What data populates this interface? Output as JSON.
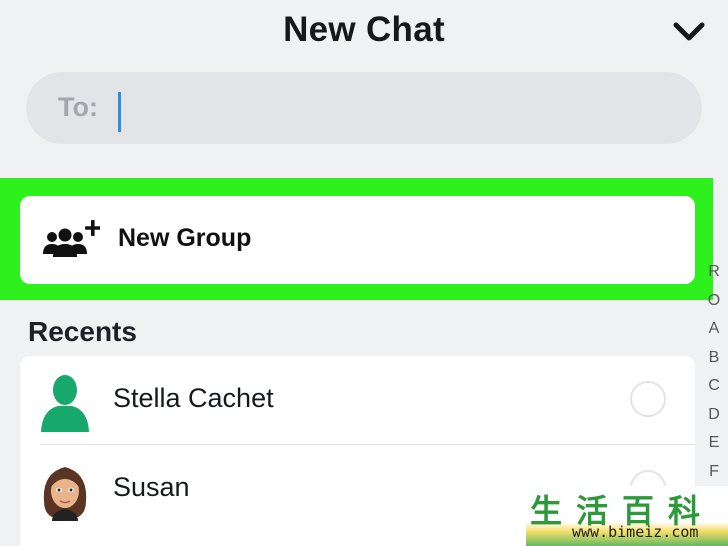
{
  "header": {
    "title": "New Chat",
    "collapse_icon": "chevron-down-icon"
  },
  "to_field": {
    "label": "To:",
    "value": "",
    "placeholder": ""
  },
  "new_group": {
    "icon": "group-add-icon",
    "label": "New Group",
    "highlight_color": "#2ef01c"
  },
  "recents": {
    "title": "Recents",
    "contacts": [
      {
        "name": "Stella Cachet",
        "avatar": "default-ghost-avatar-icon",
        "avatar_color": "#17a86b",
        "selected": false
      },
      {
        "name": "Susan",
        "avatar": "bitmoji-avatar-icon",
        "selected": false
      }
    ]
  },
  "alphabet_index": [
    "R",
    "O",
    "A",
    "B",
    "C",
    "D",
    "E",
    "F"
  ],
  "watermark": {
    "chinese": "生活百科",
    "url": "www.bimeiz.com"
  },
  "colors": {
    "background": "#f0f1f3",
    "accent_caret": "#2a8fe0"
  }
}
